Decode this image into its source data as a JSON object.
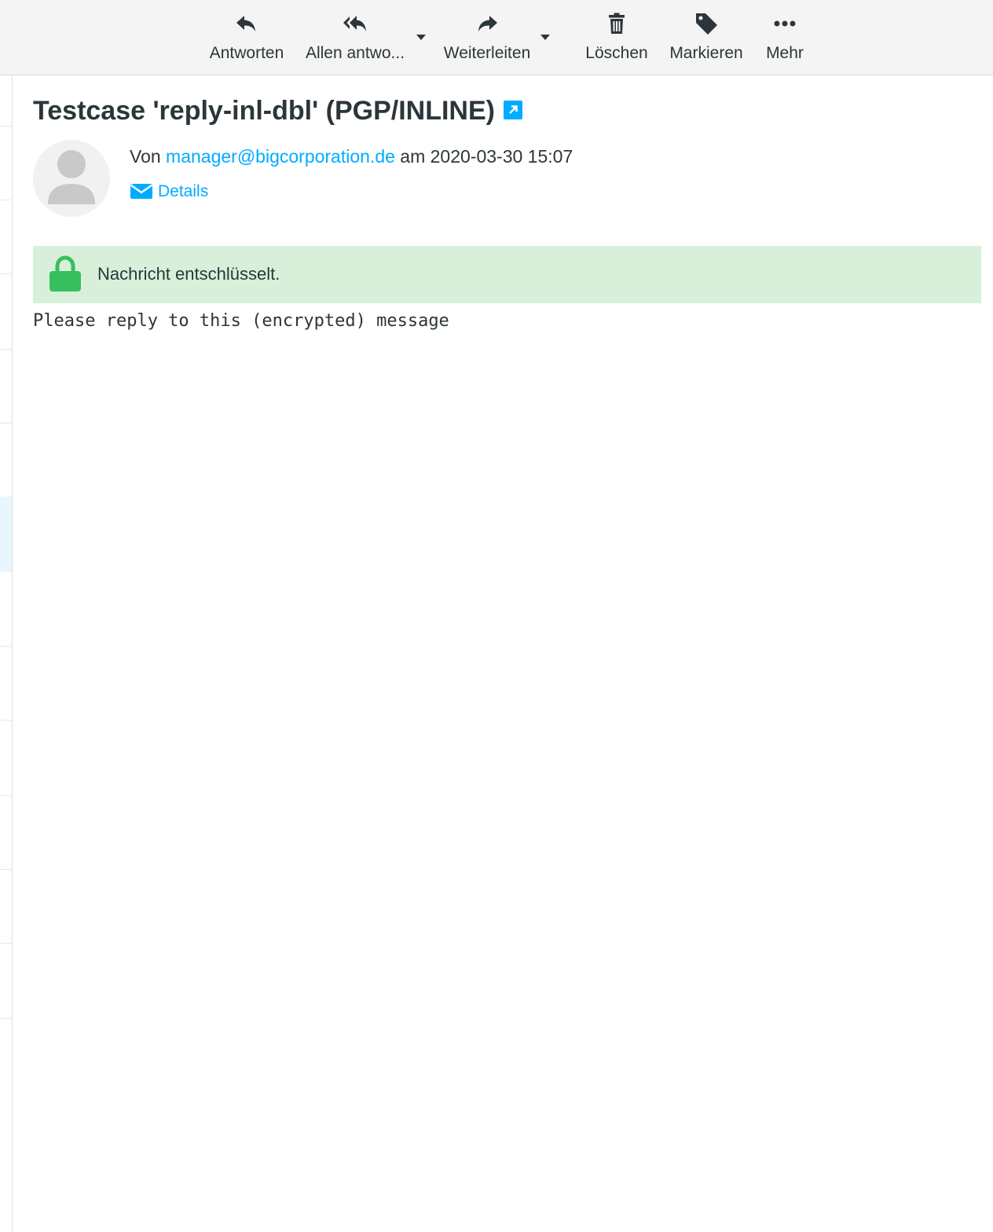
{
  "toolbar": {
    "reply_label": "Antworten",
    "reply_all_label": "Allen antwo...",
    "forward_label": "Weiterleiten",
    "delete_label": "Löschen",
    "mark_label": "Markieren",
    "more_label": "Mehr"
  },
  "message": {
    "subject": "Testcase 'reply-inl-dbl' (PGP/INLINE)",
    "from_prefix": "Von",
    "sender": "manager@bigcorporation.de",
    "date_prefix": "am",
    "date": "2020-03-30 15:07",
    "details_label": "Details",
    "notice": "Nachricht entschlüsselt.",
    "body": "Please reply to this (encrypted) message"
  },
  "colors": {
    "accent": "#00acff",
    "notice_bg": "#d8f0da",
    "lock": "#37be5f",
    "toolbar_bg": "#f4f4f4"
  },
  "icons": {
    "reply": "reply-icon",
    "reply_all": "reply-all-icon",
    "forward": "forward-icon",
    "delete": "trash-icon",
    "mark": "tag-icon",
    "more": "more-icon",
    "external": "external-link-icon",
    "details": "envelope-icon",
    "lock": "lock-icon"
  }
}
